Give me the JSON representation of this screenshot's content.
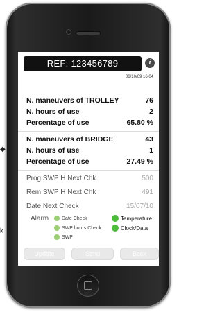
{
  "screen": {
    "ref": "REF: 123456789",
    "datetime": "06/10/09 16:04",
    "info_icon": "i",
    "trolley": {
      "maneuvers_label": "N. maneuvers of TROLLEY",
      "maneuvers_value": "76",
      "hours_label": "N. hours of use",
      "hours_value": "2",
      "percent_label": "Percentage of use",
      "percent_value": "65.80 %"
    },
    "bridge": {
      "maneuvers_label": "N. maneuvers of BRIDGE",
      "maneuvers_value": "43",
      "hours_label": "N. hours of use",
      "hours_value": "1",
      "percent_label": "Percentage of use",
      "percent_value": "27.49 %"
    },
    "prog_swp": {
      "label": "Prog SWP H Next Chk.",
      "value": "500"
    },
    "rem_swp": {
      "label": "Rem SWP H Next Chk",
      "value": "491"
    },
    "date_next": {
      "label": "Date Next Check",
      "value": "15/07/10"
    },
    "alarm": {
      "label": "Alarm",
      "indicators": {
        "date_check": "Date Check",
        "temperature": "Temperature",
        "swp_hours_check": "SWP hours Check",
        "clock_data": "Clock/Data",
        "swp": "SWP"
      }
    },
    "buttons": {
      "update": "Update",
      "send": "Send",
      "back": "Back"
    }
  },
  "edge_marks": {
    "left_arrow": "◆",
    "left_k": "k"
  },
  "colors": {
    "indicator_light": "#9ccf73",
    "indicator_green": "#4dbb3b",
    "ref_bar": "#111111"
  }
}
